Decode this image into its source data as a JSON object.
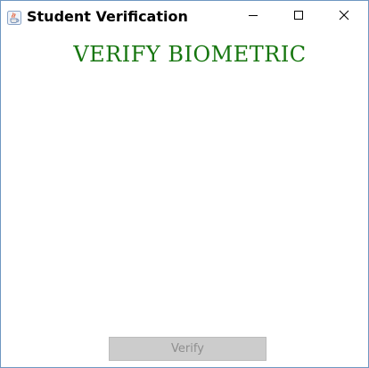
{
  "window": {
    "title": "Student Verification",
    "app_icon": "java-coffee-cup-icon",
    "controls": {
      "minimize_icon": "minimize-icon",
      "maximize_icon": "maximize-icon",
      "close_icon": "close-icon"
    }
  },
  "main": {
    "heading": "VERIFY BIOMETRIC",
    "heading_color": "#16760f",
    "verify_button_label": "Verify",
    "verify_button_enabled": false
  }
}
